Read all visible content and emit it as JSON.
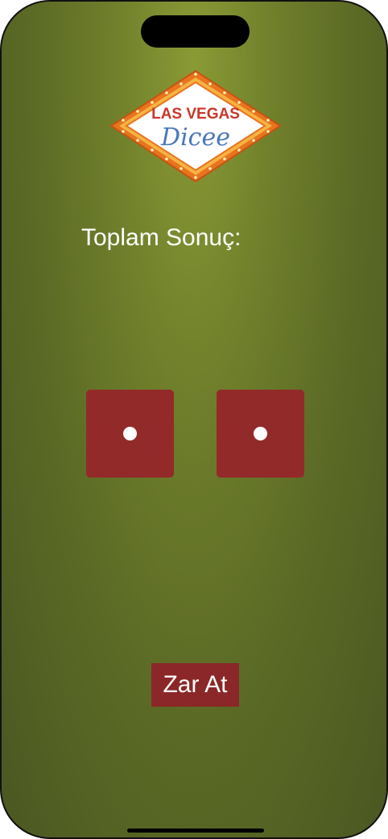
{
  "logo": {
    "line1": "LAS VEGAS",
    "line2": "Dicee"
  },
  "result": {
    "label": "Toplam Sonuç:"
  },
  "dice": [
    {
      "value": 1
    },
    {
      "value": 1
    }
  ],
  "actions": {
    "roll_label": "Zar At"
  },
  "colors": {
    "background": "#6f7f2b",
    "die": "#932a2a",
    "button": "#8b2728",
    "text": "#ffffff"
  }
}
